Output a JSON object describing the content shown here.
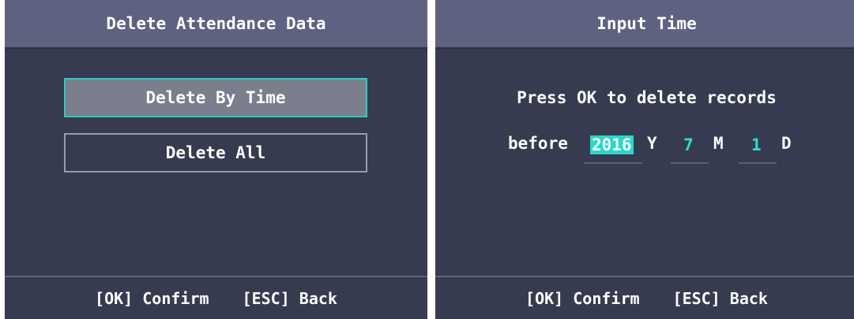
{
  "left_screen": {
    "title": "Delete Attendance Data",
    "menu": [
      {
        "label": "Delete By Time",
        "selected": true
      },
      {
        "label": "Delete All",
        "selected": false
      }
    ],
    "footer": {
      "ok": "[OK] Confirm",
      "esc": "[ESC] Back"
    }
  },
  "right_screen": {
    "title": "Input Time",
    "prompt": "Press OK to delete records",
    "before_label": "before",
    "year": {
      "value": "2016",
      "unit": "Y",
      "focused": true
    },
    "month": {
      "value": "7",
      "unit": "M"
    },
    "day": {
      "value": "1",
      "unit": "D"
    },
    "footer": {
      "ok": "[OK] Confirm",
      "esc": "[ESC] Back"
    }
  },
  "colors": {
    "background": "#373b4f",
    "titlebar": "#5e6180",
    "accent": "#26d9cb",
    "selected_item": "#7c7e8d"
  }
}
